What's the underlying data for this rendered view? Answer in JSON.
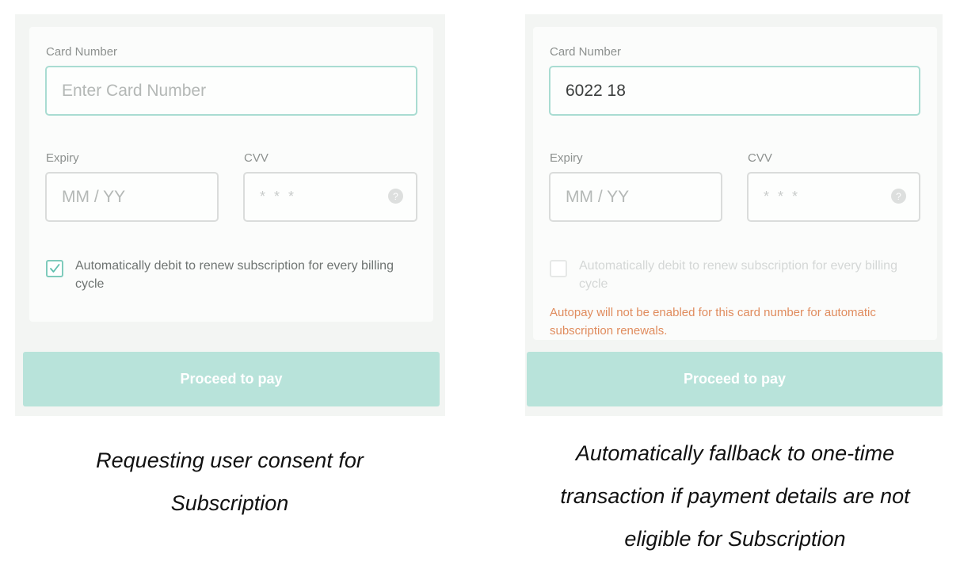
{
  "left_panel": {
    "card_number_label": "Card Number",
    "card_number_placeholder": "Enter Card Number",
    "expiry_label": "Expiry",
    "expiry_placeholder": "MM / YY",
    "cvv_label": "CVV",
    "cvv_placeholder": "* * *",
    "cvv_help": "?",
    "autodebit_checked": true,
    "autodebit_text": "Automatically debit to renew subscription for every billing cycle",
    "pay_button": "Proceed to pay",
    "caption": "Requesting user consent for Subscription"
  },
  "right_panel": {
    "card_number_label": "Card Number",
    "card_number_value": "6022 18",
    "expiry_label": "Expiry",
    "expiry_placeholder": "MM / YY",
    "cvv_label": "CVV",
    "cvv_placeholder": "* * *",
    "cvv_help": "?",
    "autodebit_checked": false,
    "autodebit_text": "Automatically debit to renew subscription for every billing cycle",
    "warning": "Autopay will not be enabled for this card number for automatic subscription renewals.",
    "pay_button": "Proceed to pay",
    "caption": "Automatically fallback to one-time transaction if payment details are not eligible for Subscription"
  },
  "colors": {
    "accent": "#a9dcd2",
    "button": "#b8e3da",
    "warning": "#e08c5e"
  }
}
